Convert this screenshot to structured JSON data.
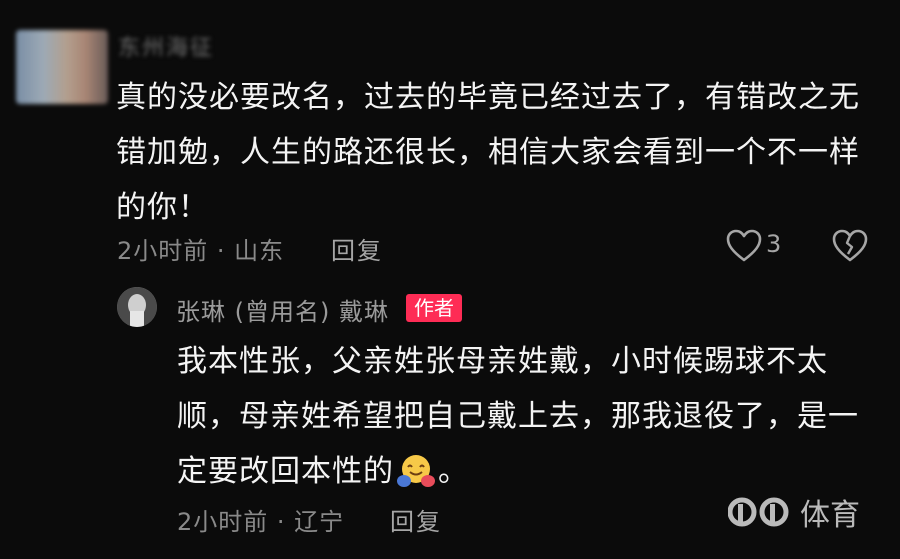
{
  "top_comment": {
    "username_blurred": "东州海征",
    "text": "真的没必要改名，过去的毕竟已经过去了，有错改之无错加勉，人生的路还很长，相信大家会看到一个不一样的你！",
    "time_location": "2小时前 · 山东",
    "reply_label": "回复",
    "like_count": "3"
  },
  "reply": {
    "username": "张琳 (曾用名) 戴琳",
    "author_badge": "作者",
    "text_before_emoji": "我本性张，父亲姓张母亲姓戴，小时候踢球不太顺，母亲姓希望把自己戴上去，那我退役了，是一定要改回本性的",
    "text_after_emoji": "。",
    "time_location": "2小时前 · 辽宁",
    "reply_label": "回复"
  },
  "watermark": {
    "text": "体育"
  },
  "icons": {
    "like": "heart-outline-icon",
    "dislike": "broken-heart-icon",
    "emoji": "hugging-face-emoji"
  }
}
